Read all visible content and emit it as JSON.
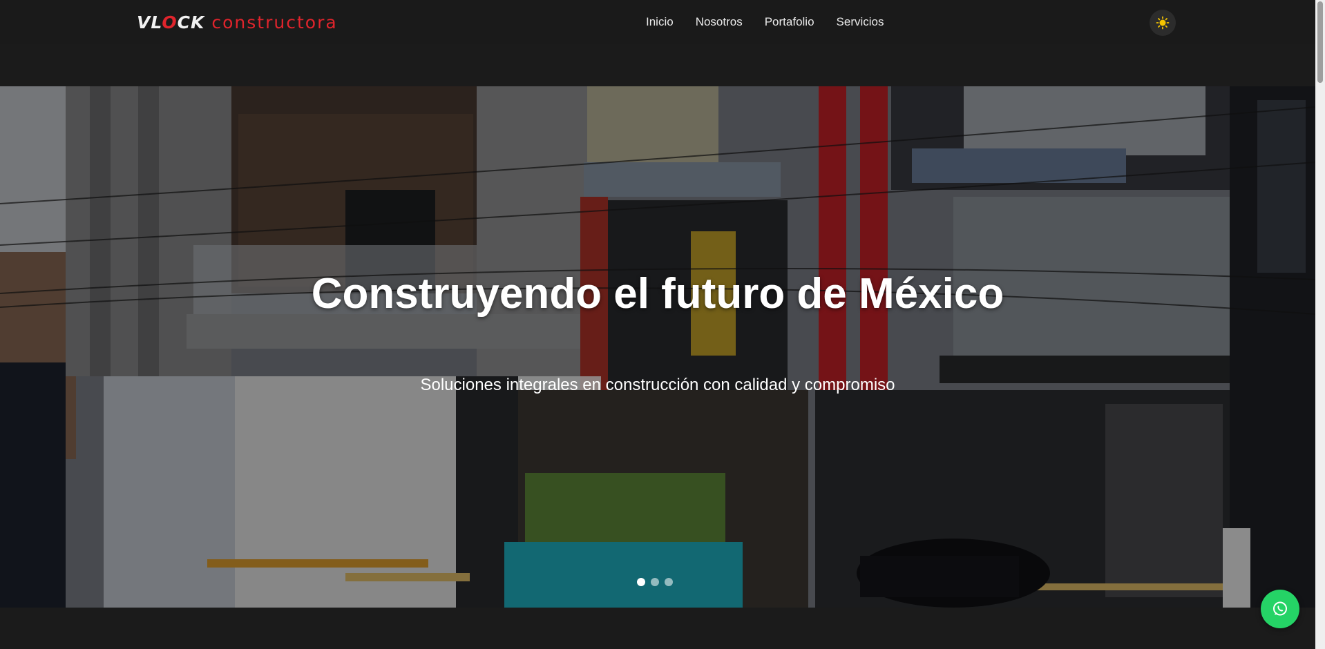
{
  "header": {
    "logo_word1": "VL",
    "logo_word1_o": "O",
    "logo_word1_end": "CK",
    "logo_word2": "constructora",
    "nav": [
      "Inicio",
      "Nosotros",
      "Portafolio",
      "Servicios"
    ],
    "theme_icon": "sun-icon"
  },
  "hero": {
    "title": "Construyendo el futuro de México",
    "subtitle": "Soluciones integrales en construcción con calidad y compromiso",
    "slides_total": 3,
    "active_slide": 1
  },
  "whatsapp": {
    "icon": "whatsapp-icon"
  },
  "colors": {
    "brand_red": "#e0242c",
    "background": "#1b1b1b",
    "whatsapp_green": "#25d366"
  }
}
